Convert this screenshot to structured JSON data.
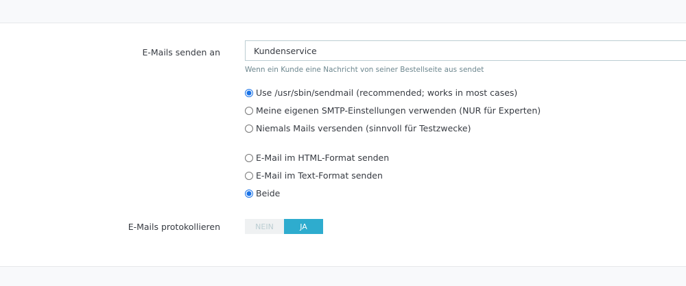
{
  "email_to": {
    "label": "E-Mails senden an",
    "value": "Kundenservice",
    "help": "Wenn ein Kunde eine Nachricht von seiner Bestellseite aus sendet"
  },
  "send_method": {
    "options": [
      {
        "label": "Use /usr/sbin/sendmail (recommended; works in most cases)",
        "checked": true
      },
      {
        "label": "Meine eigenen SMTP-Einstellungen verwenden (NUR für Experten)",
        "checked": false
      },
      {
        "label": "Niemals Mails versenden (sinnvoll für Testzwecke)",
        "checked": false
      }
    ]
  },
  "format": {
    "options": [
      {
        "label": "E-Mail im HTML-Format senden",
        "checked": false
      },
      {
        "label": "E-Mail im Text-Format senden",
        "checked": false
      },
      {
        "label": "Beide",
        "checked": true
      }
    ]
  },
  "log": {
    "label": "E-Mails protokollieren",
    "no": "NEIN",
    "yes": "JA",
    "value": "JA"
  },
  "colors": {
    "accent": "#2eacce"
  }
}
